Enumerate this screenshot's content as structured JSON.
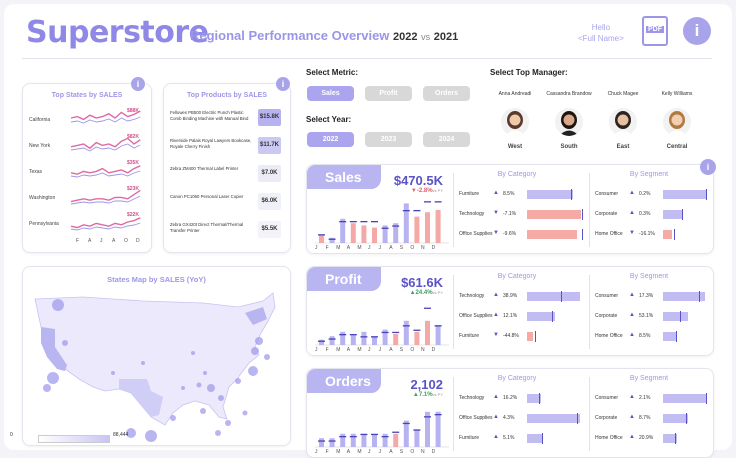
{
  "header": {
    "logo": "Superstore",
    "title": "Regional Performance Overview",
    "year_a": "2022",
    "vs": "vs",
    "year_b": "2021",
    "hello": "Hello",
    "user": "<Full Name>",
    "pdf_label": "PDF",
    "info": "i"
  },
  "top_states": {
    "title": "Top States by SALES",
    "months": [
      "F",
      "A",
      "J",
      "A",
      "O",
      "D"
    ],
    "rows": [
      {
        "name": "California",
        "label": "$88K"
      },
      {
        "name": "New York",
        "label": "$82K"
      },
      {
        "name": "Texas",
        "label": "$35K"
      },
      {
        "name": "Washington",
        "label": "$23K"
      },
      {
        "name": "Pennsylvania",
        "label": "$22K"
      }
    ]
  },
  "top_products": {
    "title": "Top Products by SALES",
    "rows": [
      {
        "name": "Fellowes PB500 Electric Punch Plastic Comb Binding Machine with Manual Bind",
        "value": "$15.8K",
        "color": "#b7b3f0"
      },
      {
        "name": "Riverside Palais Royal Lawyers Bookcase, Royale Cherry Finish",
        "value": "$11.7K",
        "color": "#cbc8f4"
      },
      {
        "name": "Zebra ZM400 Thermal Label Printer",
        "value": "$7.0K",
        "color": "#ececf7"
      },
      {
        "name": "Canon PC1060 Personal Laser Copier",
        "value": "$6.0K",
        "color": "#f0f0f8"
      },
      {
        "name": "Zebra GX420t Direct Thermal/Thermal Transfer Printer",
        "value": "$5.5K",
        "color": "#f3f3f9"
      }
    ]
  },
  "map": {
    "title_a": "States Map by",
    "title_b": "SALES (YoY)",
    "legend_min": "0",
    "legend_max": "88,444"
  },
  "metric": {
    "label": "Select Metric:",
    "options": [
      "Sales",
      "Profit",
      "Orders"
    ],
    "selected": "Sales"
  },
  "year": {
    "label": "Select Year:",
    "options": [
      "2022",
      "2023",
      "2024"
    ],
    "selected": "2022"
  },
  "managers": {
    "label": "Select Top Manager:",
    "people": [
      {
        "name": "Anna Andreadi",
        "region": "West"
      },
      {
        "name": "Cassandra Brandow",
        "region": "South"
      },
      {
        "name": "Chuck Magee",
        "region": "East"
      },
      {
        "name": "Kelly Williams",
        "region": "Central"
      }
    ]
  },
  "kpis": [
    {
      "name": "Sales",
      "value": "$470.5K",
      "change": "▼-2.8%",
      "change_suffix": "vs PY",
      "change_color": "#e06070",
      "months": [
        "J",
        "F",
        "M",
        "A",
        "M",
        "J",
        "J",
        "A",
        "S",
        "O",
        "N",
        "D"
      ],
      "bars": [
        0.18,
        0.12,
        0.55,
        0.45,
        0.4,
        0.35,
        0.4,
        0.45,
        0.9,
        0.6,
        0.7,
        0.75
      ],
      "prev": [
        0.2,
        0.1,
        0.5,
        0.5,
        0.5,
        0.5,
        0.35,
        0.4,
        0.75,
        0.75,
        0.95,
        0.95
      ],
      "category_title": "By Category",
      "segment_title": "By Segment",
      "categories": [
        {
          "name": "Furniture",
          "dir": "▲",
          "pct": "8.5%",
          "fill": 0.82,
          "tick": 0.78,
          "pos": true
        },
        {
          "name": "Technology",
          "dir": "▼",
          "pct": "-7.1%",
          "fill": 0.97,
          "tick": 0.99,
          "pos": false
        },
        {
          "name": "Office Supplies",
          "dir": "▼",
          "pct": "-9.6%",
          "fill": 0.9,
          "tick": 0.98,
          "pos": false
        }
      ],
      "segments": [
        {
          "name": "Consumer",
          "dir": "▲",
          "pct": "0.2%",
          "fill": 0.95,
          "tick": 0.94,
          "pos": true
        },
        {
          "name": "Corporate",
          "dir": "▲",
          "pct": "0.3%",
          "fill": 0.42,
          "tick": 0.42,
          "pos": true
        },
        {
          "name": "Home Office",
          "dir": "▼",
          "pct": "-16.1%",
          "fill": 0.2,
          "tick": 0.24,
          "pos": false
        }
      ]
    },
    {
      "name": "Profit",
      "value": "$61.6K",
      "change": "▲24.4%",
      "change_suffix": "vs PY",
      "change_color": "#3aa060",
      "months": [
        "J",
        "F",
        "M",
        "A",
        "M",
        "J",
        "J",
        "A",
        "S",
        "O",
        "N",
        "D"
      ],
      "bars": [
        0.12,
        0.2,
        0.3,
        0.25,
        0.3,
        0.2,
        0.35,
        0.25,
        0.55,
        0.3,
        0.55,
        0.45
      ],
      "prev": [
        0.1,
        0.15,
        0.25,
        0.25,
        0.2,
        0.2,
        0.3,
        0.3,
        0.45,
        0.35,
        0.85,
        0.45
      ],
      "category_title": "By Category",
      "segment_title": "By Segment",
      "categories": [
        {
          "name": "Technology",
          "dir": "▲",
          "pct": "38.9%",
          "fill": 0.95,
          "tick": 0.6,
          "pos": true
        },
        {
          "name": "Office Supplies",
          "dir": "▲",
          "pct": "12.1%",
          "fill": 0.5,
          "tick": 0.45,
          "pos": true
        },
        {
          "name": "Furniture",
          "dir": "▼",
          "pct": "-44.8%",
          "fill": 0.1,
          "tick": 0.15,
          "pos": false
        }
      ],
      "segments": [
        {
          "name": "Consumer",
          "dir": "▲",
          "pct": "17.3%",
          "fill": 0.92,
          "tick": 0.78,
          "pos": true
        },
        {
          "name": "Corporate",
          "dir": "▲",
          "pct": "53.1%",
          "fill": 0.55,
          "tick": 0.36,
          "pos": true
        },
        {
          "name": "Home Office",
          "dir": "▲",
          "pct": "8.5%",
          "fill": 0.3,
          "tick": 0.28,
          "pos": true
        }
      ]
    },
    {
      "name": "Orders",
      "value": "2,102",
      "change": "▲7.1%",
      "change_suffix": "vs PY",
      "change_color": "#3aa060",
      "months": [
        "J",
        "F",
        "M",
        "A",
        "M",
        "J",
        "J",
        "A",
        "S",
        "O",
        "N",
        "D"
      ],
      "bars": [
        0.2,
        0.2,
        0.3,
        0.3,
        0.3,
        0.3,
        0.3,
        0.3,
        0.6,
        0.4,
        0.8,
        0.8
      ],
      "prev": [
        0.15,
        0.15,
        0.25,
        0.25,
        0.3,
        0.3,
        0.25,
        0.35,
        0.55,
        0.4,
        0.7,
        0.75
      ],
      "category_title": "By Category",
      "segment_title": "By Segment",
      "categories": [
        {
          "name": "Technology",
          "dir": "▲",
          "pct": "16.2%",
          "fill": 0.25,
          "tick": 0.22,
          "pos": true
        },
        {
          "name": "Office Supplies",
          "dir": "▲",
          "pct": "4.3%",
          "fill": 0.95,
          "tick": 0.9,
          "pos": true
        },
        {
          "name": "Furniture",
          "dir": "▲",
          "pct": "5.1%",
          "fill": 0.28,
          "tick": 0.27,
          "pos": true
        }
      ],
      "segments": [
        {
          "name": "Consumer",
          "dir": "▲",
          "pct": "2.1%",
          "fill": 0.95,
          "tick": 0.93,
          "pos": true
        },
        {
          "name": "Corporate",
          "dir": "▲",
          "pct": "8.7%",
          "fill": 0.55,
          "tick": 0.5,
          "pos": true
        },
        {
          "name": "Home Office",
          "dir": "▲",
          "pct": "20.9%",
          "fill": 0.3,
          "tick": 0.25,
          "pos": true
        }
      ]
    }
  ]
}
